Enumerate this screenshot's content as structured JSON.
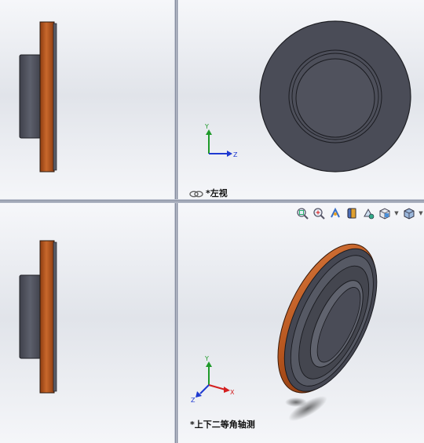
{
  "viewports": {
    "top_left": {},
    "top_right": {
      "label": "*左视",
      "link_icon": "link-icon",
      "triad": {
        "x": "",
        "y": "Y",
        "z": "Z"
      }
    },
    "bottom_left": {},
    "bottom_right": {
      "label": "*上下二等角轴测",
      "triad": {
        "x": "X",
        "y": "Y",
        "z": "Z"
      }
    }
  },
  "heads_up_toolbar": {
    "icons": [
      "zoom-to-fit-icon",
      "zoom-to-area-icon",
      "previous-view-icon",
      "section-view-icon",
      "dynamic-annotation-icon",
      "view-orientation-icon",
      "display-style-icon"
    ]
  },
  "colors": {
    "part_face": "#4a4c57",
    "flange_copper": "#b5541d",
    "axis_x": "#d42020",
    "axis_y": "#1f9a2a",
    "axis_z": "#1f3ad1"
  }
}
